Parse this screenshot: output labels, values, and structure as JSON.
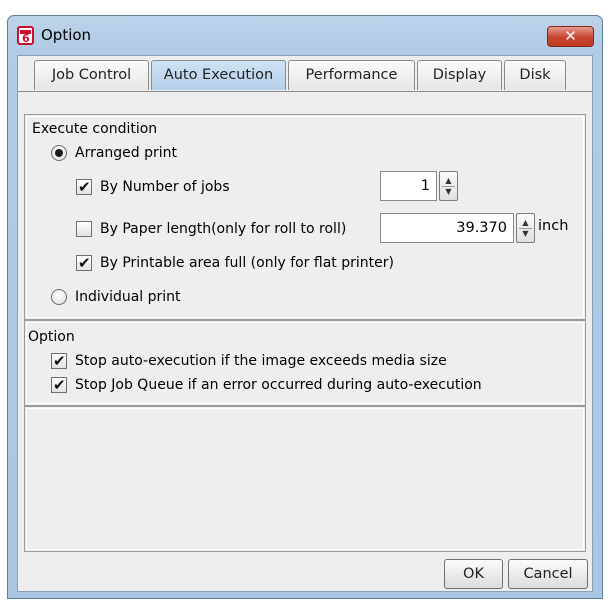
{
  "window": {
    "title": "Option"
  },
  "tabs": [
    {
      "label": "Job Control",
      "active": false
    },
    {
      "label": "Auto Execution",
      "active": true
    },
    {
      "label": "Performance",
      "active": false
    },
    {
      "label": "Display",
      "active": false
    },
    {
      "label": "Disk",
      "active": false
    }
  ],
  "execute_condition": {
    "title": "Execute condition",
    "arranged_print": {
      "label": "Arranged print",
      "selected": true
    },
    "by_number_of_jobs": {
      "label": "By Number of jobs",
      "checked": true,
      "value": "1"
    },
    "by_paper_length": {
      "label": "By Paper length(only for roll to roll)",
      "checked": false,
      "value": "39.370",
      "unit": "inch"
    },
    "by_printable_area": {
      "label": "By Printable area full (only for flat printer)",
      "checked": true
    },
    "individual_print": {
      "label": "Individual print",
      "selected": false
    }
  },
  "option": {
    "title": "Option",
    "stop_auto_execution": {
      "label": "Stop auto-execution if the image exceeds media size",
      "checked": true
    },
    "stop_job_queue": {
      "label": "Stop Job Queue if an error occurred during auto-execution",
      "checked": true
    }
  },
  "buttons": {
    "ok": "OK",
    "cancel": "Cancel"
  },
  "colors": {
    "titlebar": "#b3cbe4",
    "close": "#c8452f",
    "active_tab": "#cfe2f5",
    "panel_bg": "#eeeeee"
  },
  "icons": {
    "app": "app-icon",
    "close": "close-icon",
    "spin_up": "arrow-up-icon",
    "spin_down": "arrow-down-icon"
  }
}
